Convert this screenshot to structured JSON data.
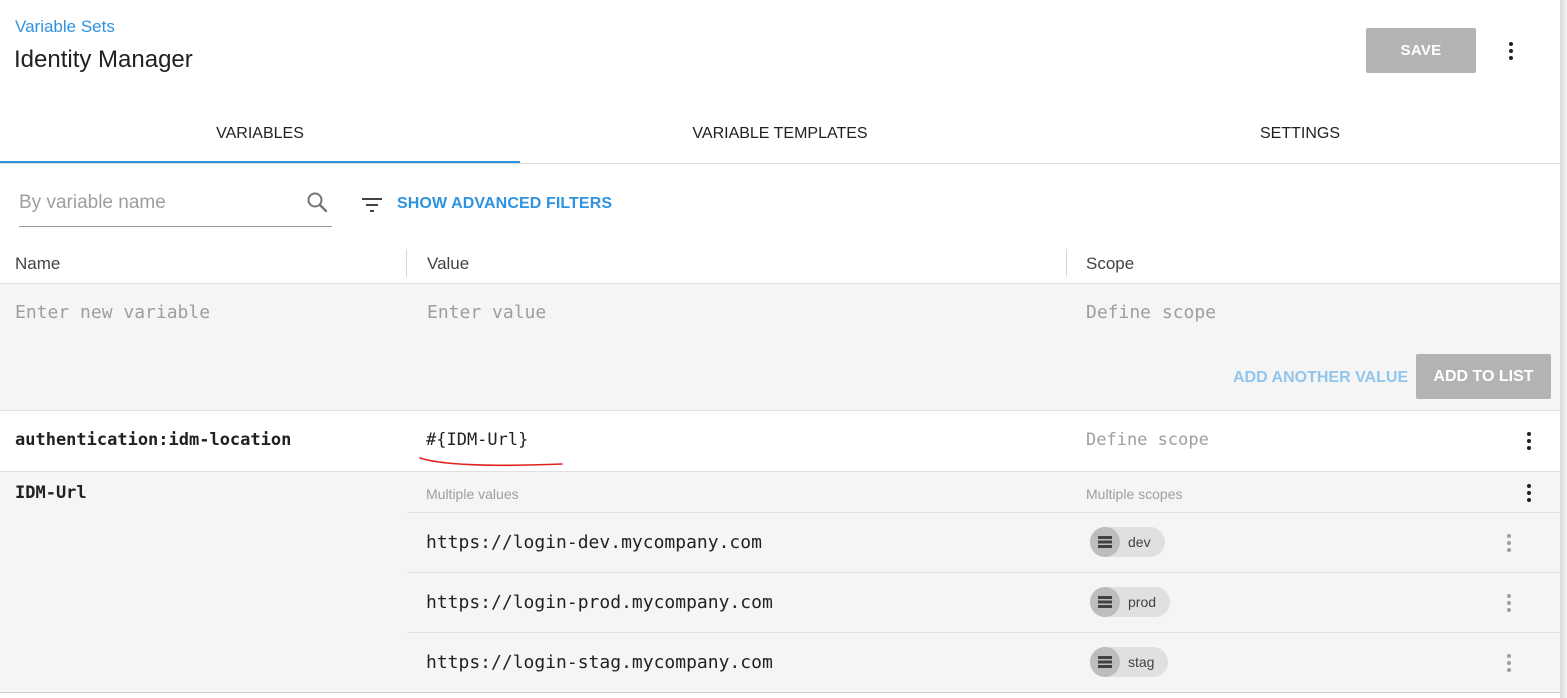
{
  "header": {
    "breadcrumb": "Variable Sets",
    "title": "Identity Manager",
    "save_label": "SAVE"
  },
  "tabs": [
    {
      "label": "VARIABLES",
      "active": true
    },
    {
      "label": "VARIABLE TEMPLATES",
      "active": false
    },
    {
      "label": "SETTINGS",
      "active": false
    }
  ],
  "filter": {
    "search_placeholder": "By variable name",
    "advanced_filters_label": "SHOW ADVANCED FILTERS"
  },
  "table": {
    "columns": [
      "Name",
      "Value",
      "Scope"
    ],
    "new_entry": {
      "name_placeholder": "Enter new variable",
      "value_placeholder": "Enter value",
      "scope_placeholder": "Define scope",
      "add_another_label": "ADD ANOTHER VALUE",
      "add_to_list_label": "ADD TO LIST"
    },
    "variables": [
      {
        "name": "authentication:idm-location",
        "value": "#{IDM-Url}",
        "scope": "Define scope"
      },
      {
        "name": "IDM-Url",
        "value_hint": "Multiple values",
        "scope_hint": "Multiple scopes",
        "values": [
          {
            "value": "https://login-dev.mycompany.com",
            "scope": "dev"
          },
          {
            "value": "https://login-prod.mycompany.com",
            "scope": "prod"
          },
          {
            "value": "https://login-stag.mycompany.com",
            "scope": "stag"
          }
        ]
      }
    ]
  },
  "colors": {
    "accent": "#2f93e0",
    "disabled_button": "#b3b3b3",
    "annotation_underline": "#e0201f"
  }
}
